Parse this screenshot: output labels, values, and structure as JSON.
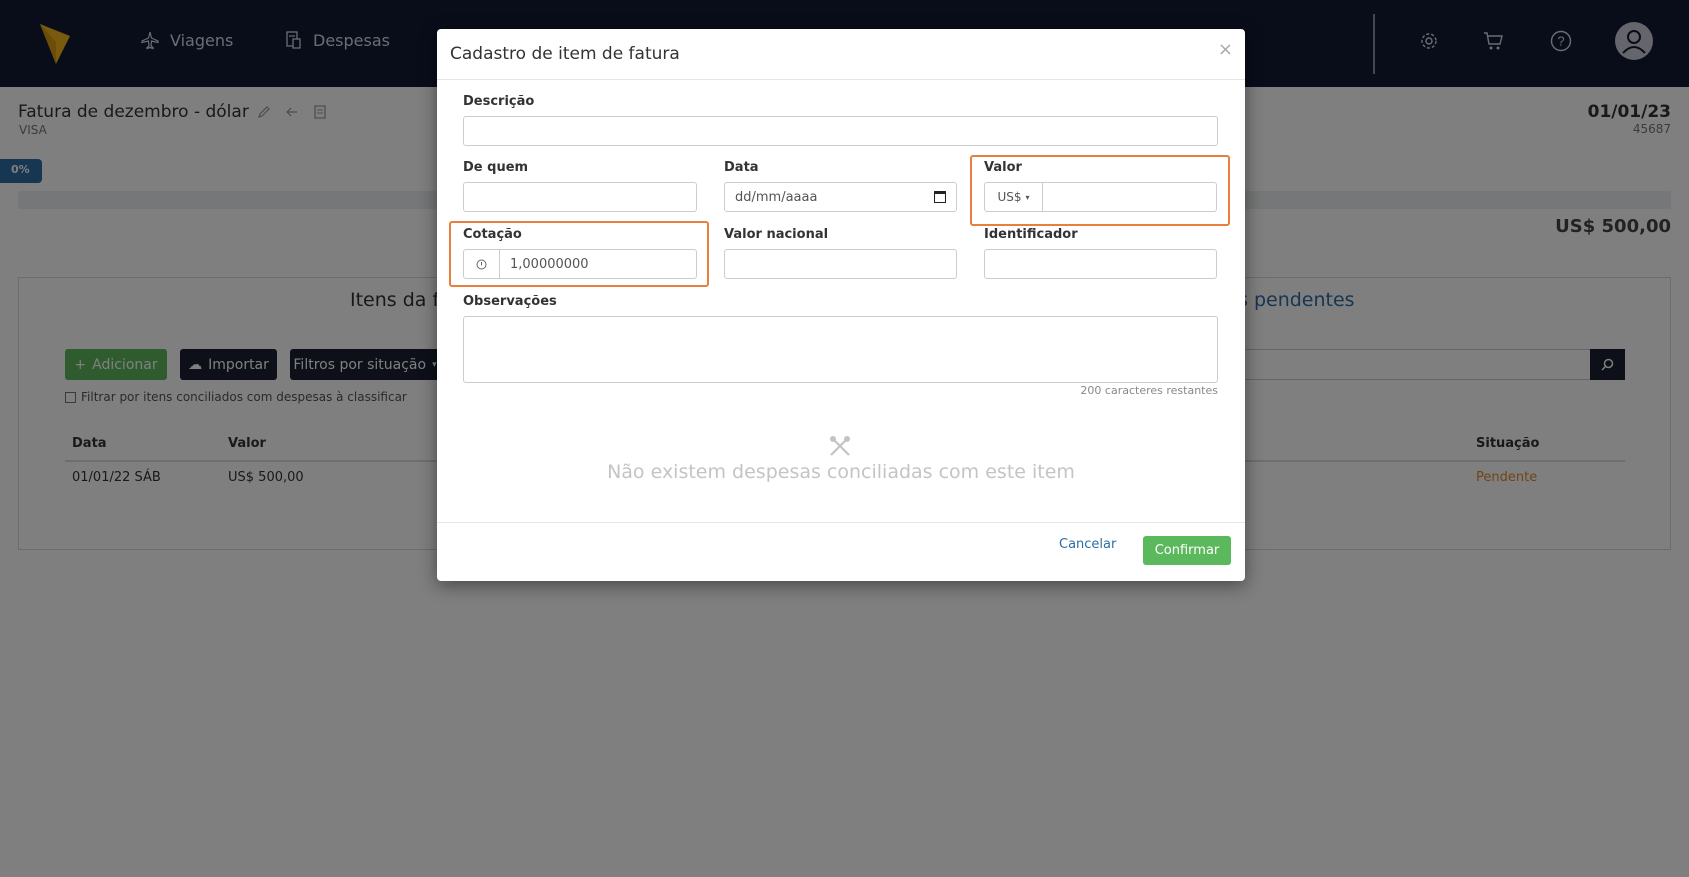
{
  "nav": {
    "items": [
      {
        "label": "Viagens",
        "icon": "airplane-icon"
      },
      {
        "label": "Despesas",
        "icon": "receipt-icon"
      }
    ]
  },
  "page": {
    "title": "Fatura de dezembro - dólar",
    "subtitle": "VISA",
    "date": "01/01/23",
    "number": "45687",
    "progress_label": "0%",
    "progress_value": 0,
    "total": "US$ 500,00",
    "tabs": [
      "Itens da fatura",
      "Despesas pendentes"
    ],
    "tab_visible": [
      "Itens da f",
      "s pendentes"
    ]
  },
  "toolbar": {
    "add_label": "Adicionar",
    "import_label": "Importar",
    "filter_label": "Filtros por situação",
    "checkbox_label": "Filtrar por itens conciliados com despesas à classificar"
  },
  "table": {
    "headers": [
      "Data",
      "Valor",
      "Situação"
    ],
    "rows": [
      {
        "data": "01/01/22 SÁB",
        "valor": "US$ 500,00",
        "situacao": "Pendente"
      }
    ]
  },
  "modal": {
    "title": "Cadastro de item de fatura",
    "close": "×",
    "fields": {
      "descricao": {
        "label": "Descrição",
        "value": ""
      },
      "de_quem": {
        "label": "De quem",
        "value": ""
      },
      "data": {
        "label": "Data",
        "placeholder": "dd/mm/aaaa"
      },
      "valor": {
        "label": "Valor",
        "currency": "US$",
        "value": ""
      },
      "cotacao": {
        "label": "Cotação",
        "value": "1,00000000"
      },
      "valor_nacional": {
        "label": "Valor nacional",
        "value": ""
      },
      "identificador": {
        "label": "Identificador",
        "value": ""
      },
      "observacoes": {
        "label": "Observações",
        "value": ""
      }
    },
    "counter": "200 caracteres restantes",
    "empty_message": "Não existem despesas conciliadas com este item",
    "cancel_label": "Cancelar",
    "confirm_label": "Confirmar"
  },
  "colors": {
    "nav_bg": "#121a33",
    "accent_green": "#5cb85c",
    "highlight_orange": "#ea7e3c",
    "link_blue": "#2d6da3",
    "pending_orange": "#e08a2c"
  }
}
